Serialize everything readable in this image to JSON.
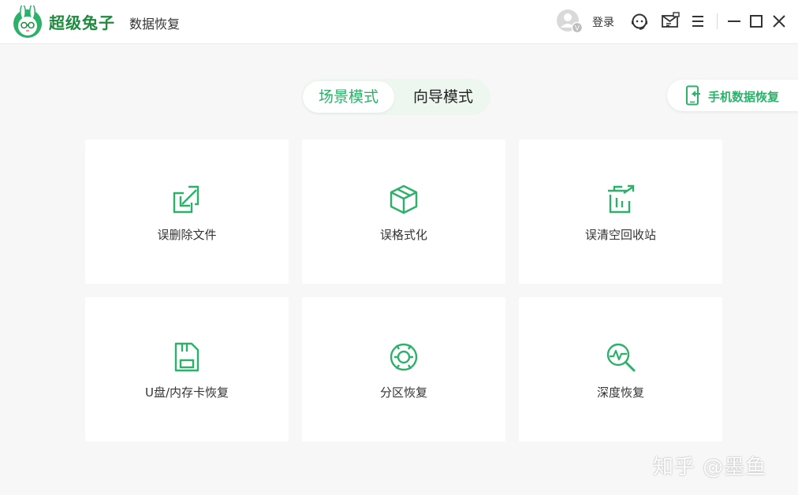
{
  "titlebar": {
    "brand_name": "超级兔子",
    "app_name": "数据恢复",
    "avatar_badge": "V",
    "login_label": "登录"
  },
  "modes": [
    {
      "label": "场景模式",
      "active": true
    },
    {
      "label": "向导模式",
      "active": false
    }
  ],
  "phone_recovery_label": "手机数据恢复",
  "cards": [
    {
      "label": "误删除文件",
      "icon": "restore-file-icon"
    },
    {
      "label": "误格式化",
      "icon": "box-icon"
    },
    {
      "label": "误清空回收站",
      "icon": "recycle-bin-icon"
    },
    {
      "label": "U盘/内存卡恢复",
      "icon": "sd-card-icon"
    },
    {
      "label": "分区恢复",
      "icon": "partition-icon"
    },
    {
      "label": "深度恢复",
      "icon": "deep-scan-icon"
    }
  ],
  "watermark": "知乎 @墨鱼",
  "colors": {
    "accent": "#2bb16a",
    "brand": "#1e8a3e",
    "background": "#f7f7f7"
  }
}
